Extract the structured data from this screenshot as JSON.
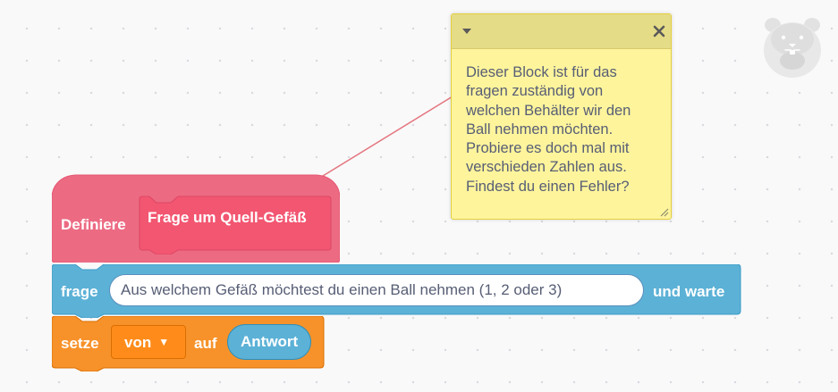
{
  "define_block": {
    "label": "Definiere",
    "prototype_label": "Frage um Quell-Gefäß",
    "color": "#ff6680"
  },
  "ask_block": {
    "label_before": "frage",
    "question": "Aus welchem Gefäß möchtest du einen Ball nehmen (1, 2 oder 3)",
    "label_after": "und warte",
    "color": "#5cb1d6"
  },
  "set_block": {
    "label_set": "setze",
    "variable": "von",
    "label_to": "auf",
    "value_reporter": "Antwort",
    "color": "#ff8c1a"
  },
  "comment": {
    "text": "Dieser Block ist für das\nfragen zuständig von\nwelchen Behälter wir den\nBall nehmen möchten.\nProbiere es doch mal mit\nverschieden Zahlen aus.\nFindest du einen Fehler?",
    "collapse_icon": "triangle-down-icon",
    "close_icon": "close-icon",
    "resize_icon": "resize-handle-icon",
    "color": "#fef49c",
    "header_color": "#e5dc88"
  },
  "sprite": {
    "icon": "hamster-sprite-icon"
  }
}
